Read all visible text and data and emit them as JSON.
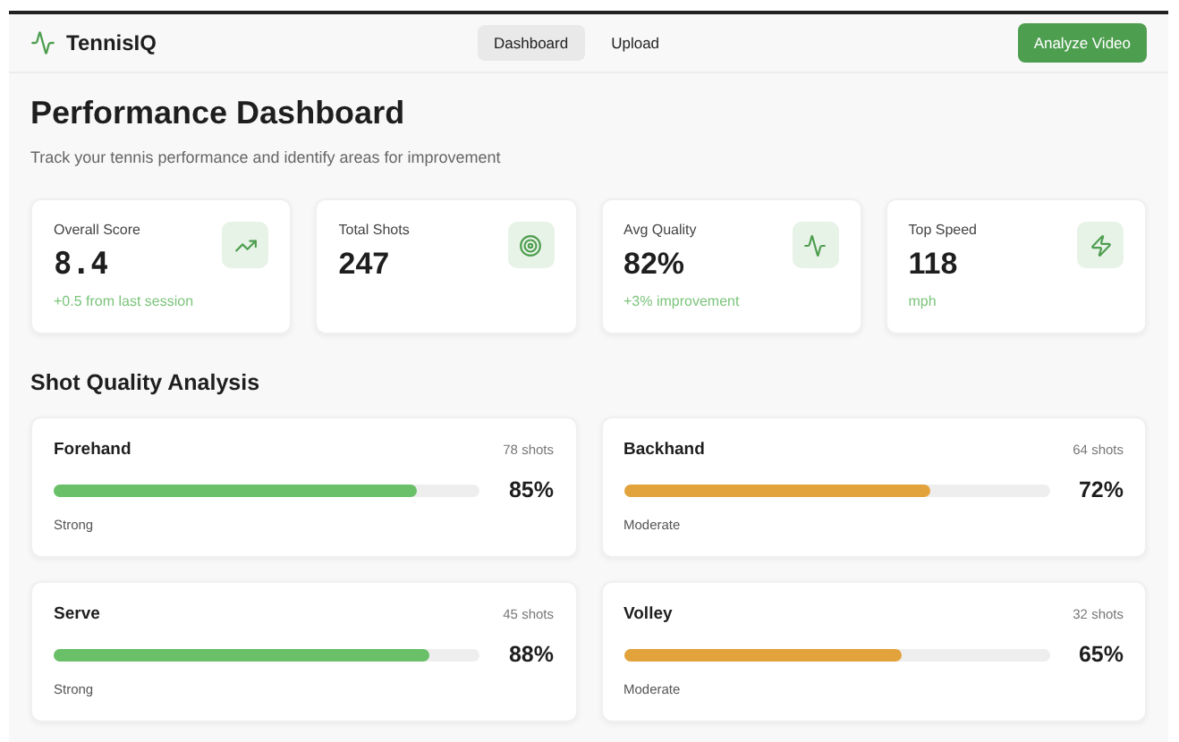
{
  "header": {
    "brand": "TennisIQ",
    "nav": [
      {
        "label": "Dashboard",
        "selected": true
      },
      {
        "label": "Upload",
        "selected": false
      }
    ],
    "action": "Analyze Video"
  },
  "page": {
    "title": "Performance Dashboard",
    "subtitle": "Track your tennis performance and identify areas for improvement"
  },
  "stats": [
    {
      "label": "Overall Score",
      "value": "8.4",
      "note": "+0.5 from last session"
    },
    {
      "label": "Total Shots",
      "value": "247"
    },
    {
      "label": "Avg Quality",
      "value": "82%",
      "note": "+3% improvement"
    },
    {
      "label": "Top Speed",
      "value": "118",
      "note": "mph"
    }
  ],
  "section_title": "Shot Quality Analysis",
  "shots": [
    {
      "name": "Forehand",
      "count": "78 shots",
      "level": 0.85,
      "percent": "85%",
      "rating": "Strong",
      "color": "#6abf69"
    },
    {
      "name": "Backhand",
      "count": "64 shots",
      "level": 0.72,
      "percent": "72%",
      "rating": "Moderate",
      "color": "#e2a33d"
    },
    {
      "name": "Serve",
      "count": "45 shots",
      "level": 0.88,
      "percent": "88%",
      "rating": "Strong",
      "color": "#6abf69"
    },
    {
      "name": "Volley",
      "count": "32 shots",
      "level": 0.65,
      "percent": "65%",
      "rating": "Moderate",
      "color": "#e2a33d"
    }
  ]
}
